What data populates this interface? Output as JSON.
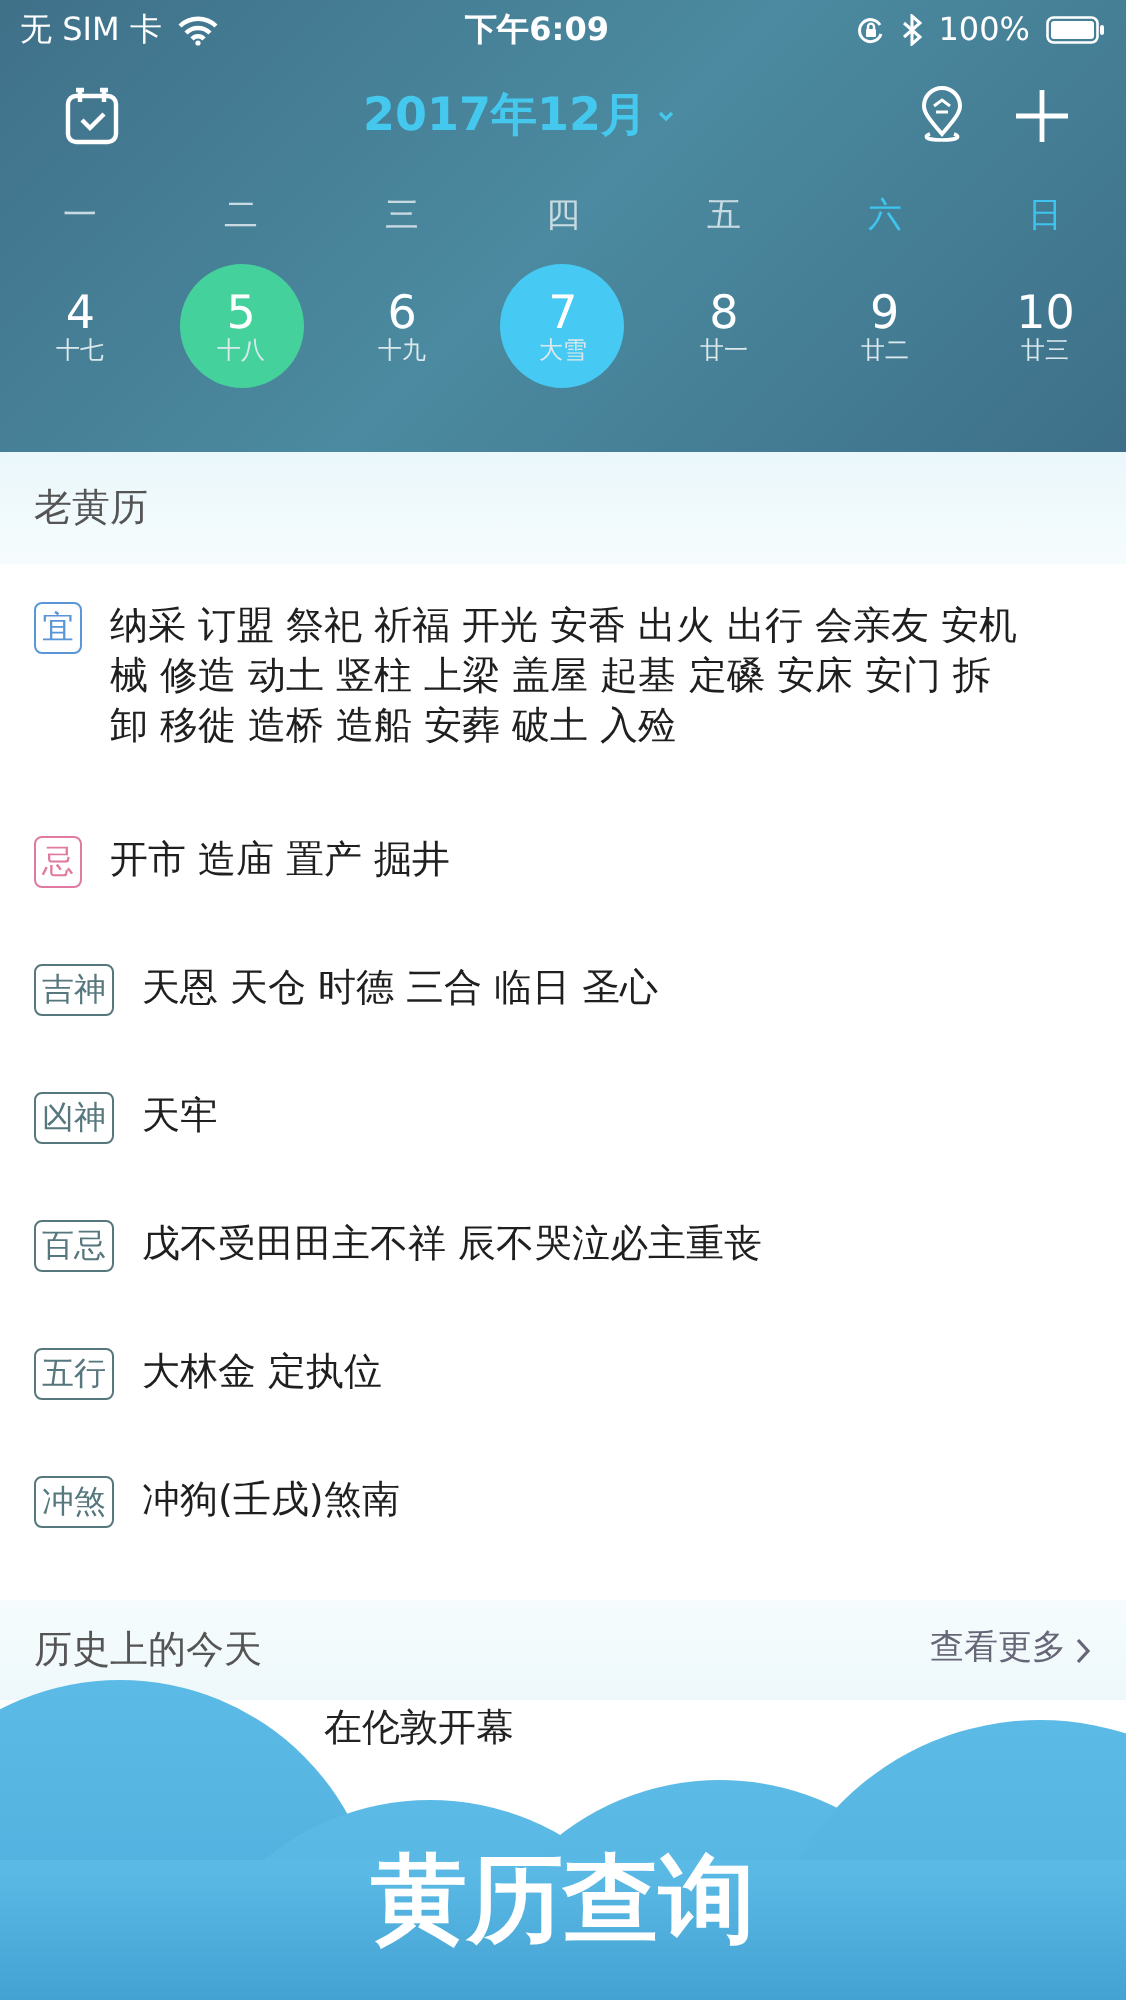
{
  "status_bar": {
    "carrier": "无 SIM 卡",
    "time": "下午6:09",
    "battery": "100%"
  },
  "header": {
    "title": "2017年12月"
  },
  "weekdays": [
    {
      "label": "一",
      "weekend": false
    },
    {
      "label": "二",
      "weekend": false
    },
    {
      "label": "三",
      "weekend": false
    },
    {
      "label": "四",
      "weekend": false
    },
    {
      "label": "五",
      "weekend": false
    },
    {
      "label": "六",
      "weekend": true
    },
    {
      "label": "日",
      "weekend": true
    }
  ],
  "days": [
    {
      "day": "4",
      "lunar": "十七",
      "selected": false,
      "today": false
    },
    {
      "day": "5",
      "lunar": "十八",
      "selected": true,
      "today": false
    },
    {
      "day": "6",
      "lunar": "十九",
      "selected": false,
      "today": false
    },
    {
      "day": "7",
      "lunar": "大雪",
      "selected": false,
      "today": true
    },
    {
      "day": "8",
      "lunar": "廿一",
      "selected": false,
      "today": false
    },
    {
      "day": "9",
      "lunar": "廿二",
      "selected": false,
      "today": false
    },
    {
      "day": "10",
      "lunar": "廿三",
      "selected": false,
      "today": false
    }
  ],
  "almanac": {
    "title": "老黄历",
    "rows": [
      {
        "tag": "宜",
        "kind": "good",
        "lines": [
          "纳采 订盟 祭祀 祈福 开光 安香 出火 出行 会亲友 安机",
          "械 修造 动土 竖柱 上梁 盖屋 起基 定磉 安床 安门 拆",
          "卸 移徙 造桥 造船 安葬 破土 入殓"
        ]
      },
      {
        "tag": "忌",
        "kind": "bad",
        "lines": [
          "开市 造庙 置产 掘井"
        ]
      },
      {
        "tag": "吉神",
        "kind": "neutral",
        "lines": [
          "天恩 天仓 时德 三合 临日 圣心"
        ]
      },
      {
        "tag": "凶神",
        "kind": "neutral",
        "lines": [
          "天牢"
        ]
      },
      {
        "tag": "百忌",
        "kind": "neutral",
        "lines": [
          "戊不受田田主不祥 辰不哭泣必主重丧"
        ]
      },
      {
        "tag": "五行",
        "kind": "neutral",
        "lines": [
          "大林金 定执位"
        ]
      },
      {
        "tag": "冲煞",
        "kind": "neutral",
        "lines": [
          "冲狗(壬戌)煞南"
        ]
      }
    ]
  },
  "history": {
    "title": "历史上的今天",
    "more": "查看更多",
    "items": [
      "在伦敦开幕"
    ]
  },
  "banner": {
    "title": "黄历查询"
  }
}
